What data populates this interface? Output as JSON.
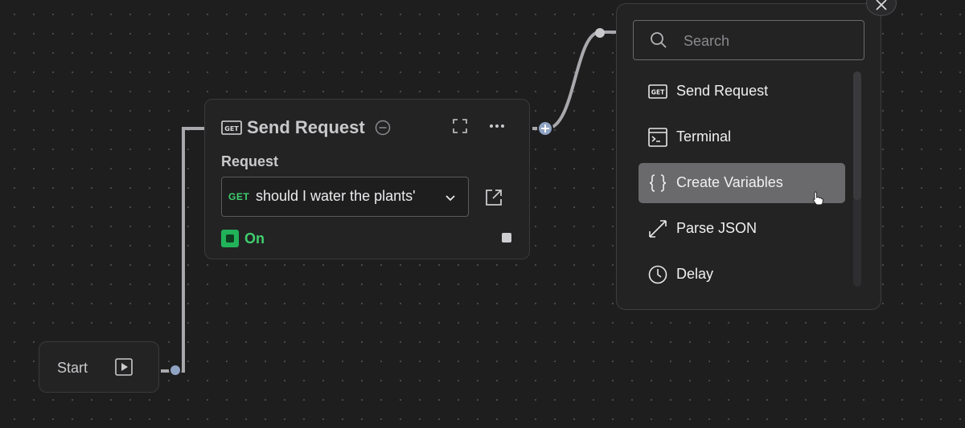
{
  "start_node": {
    "label": "Start",
    "icon": "play-icon"
  },
  "request_node": {
    "title": "Send Request",
    "title_icon": "get-icon",
    "field_label": "Request",
    "request_select": {
      "method": "GET",
      "value": "should I water the plants'"
    },
    "toggle_label": "On"
  },
  "node_picker": {
    "search": {
      "placeholder": "Search"
    },
    "items": [
      {
        "label": "Send Request",
        "icon": "get-icon"
      },
      {
        "label": "Terminal",
        "icon": "terminal-icon"
      },
      {
        "label": "Create Variables",
        "icon": "braces-icon",
        "selected": true
      },
      {
        "label": "Parse JSON",
        "icon": "arrows-icon"
      },
      {
        "label": "Delay",
        "icon": "clock-icon"
      }
    ]
  },
  "colors": {
    "canvas": "#1e1e1f",
    "node_bg": "#232324",
    "accent_green": "#22b35a",
    "edge": "#a9a9ad",
    "handle": "#8fa3c2",
    "selected_item": "#6a6a6d"
  }
}
